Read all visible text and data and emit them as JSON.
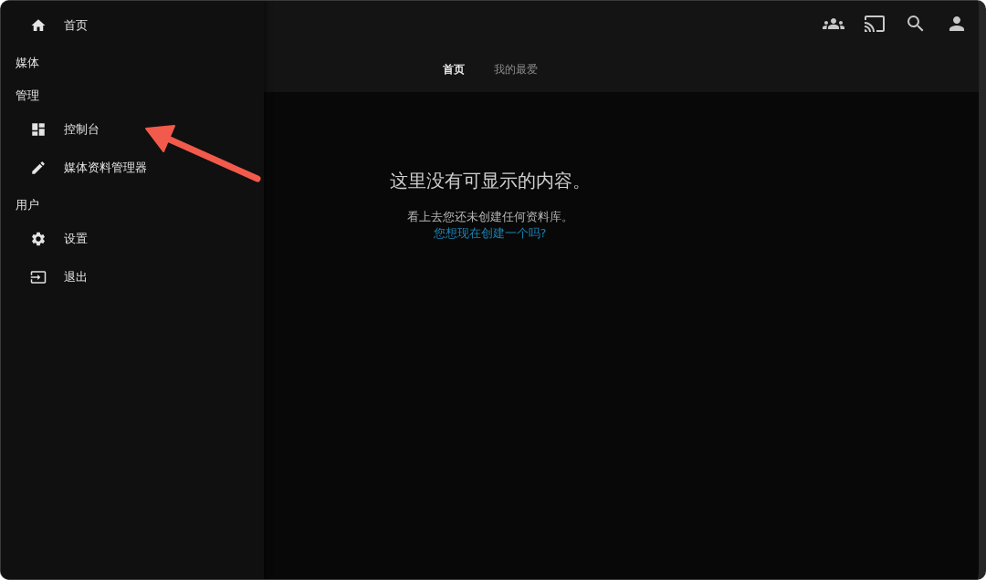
{
  "header": {
    "tabs": [
      {
        "label": "首页",
        "selected": true
      },
      {
        "label": "我的最爱",
        "selected": false
      }
    ]
  },
  "sidebar": {
    "home": {
      "label": "首页"
    },
    "sections": [
      {
        "title": "媒体"
      },
      {
        "title": "管理",
        "items": [
          {
            "label": "控制台"
          },
          {
            "label": "媒体资料管理器"
          }
        ]
      },
      {
        "title": "用户",
        "items": [
          {
            "label": "设置"
          },
          {
            "label": "退出"
          }
        ]
      }
    ]
  },
  "empty_state": {
    "title": "这里没有可显示的内容。",
    "message": "看上去您还未创建任何资料库。",
    "link": "您想现在创建一个吗?"
  }
}
